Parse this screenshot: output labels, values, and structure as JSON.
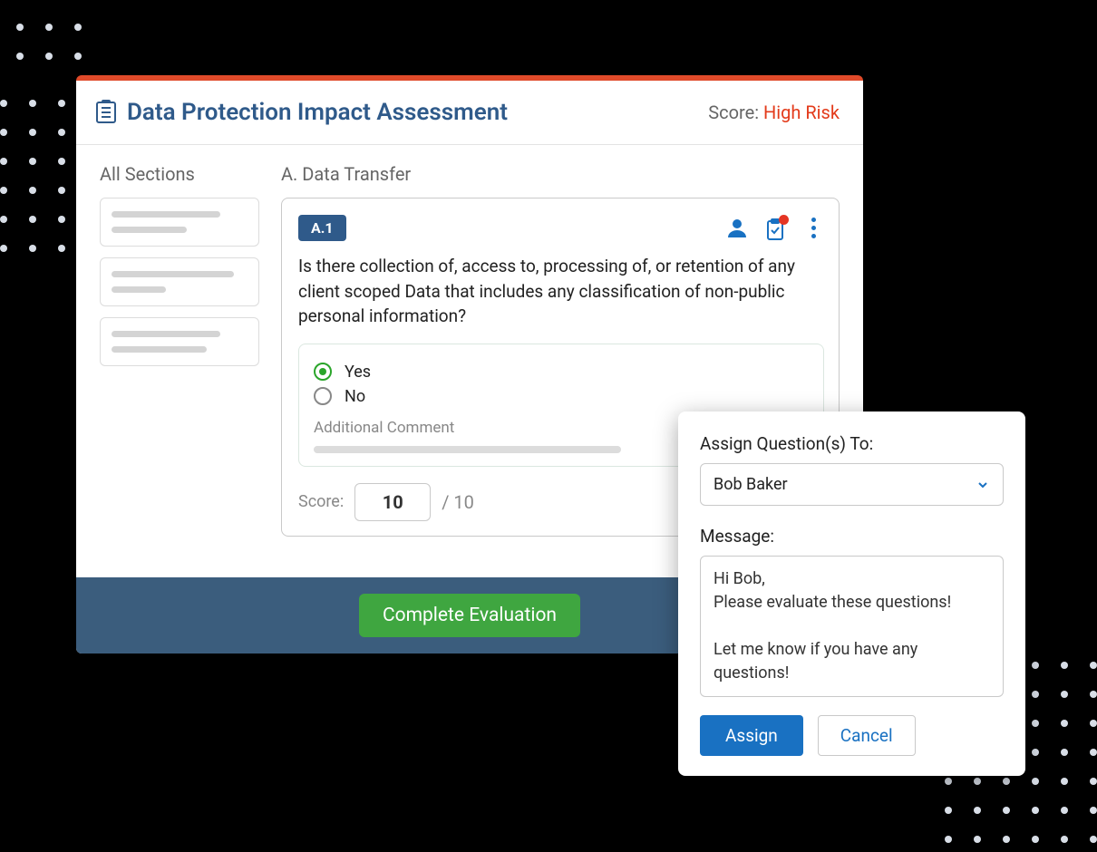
{
  "header": {
    "title": "Data Protection Impact Assessment",
    "score_label": "Score: ",
    "score_value": "High Risk"
  },
  "sidebar": {
    "heading": "All Sections"
  },
  "section": {
    "title": "A. Data Transfer"
  },
  "question": {
    "badge": "A.1",
    "text": "Is there collection of, access to, processing of, or retention of any client scoped Data that includes any classification of non-public personal information?",
    "options": {
      "yes": "Yes",
      "no": "No"
    },
    "selected": "yes",
    "comment_label": "Additional Comment",
    "score_label": "Score:",
    "score_value": "10",
    "score_max": "/ 10"
  },
  "footer": {
    "complete_label": "Complete Evaluation"
  },
  "assign": {
    "title": "Assign Question(s) To:",
    "assignee": "Bob Baker",
    "message_label": "Message:",
    "message": "Hi Bob,\nPlease evaluate these questions!\n\nLet me know if you have any questions!",
    "assign_label": "Assign",
    "cancel_label": "Cancel"
  }
}
